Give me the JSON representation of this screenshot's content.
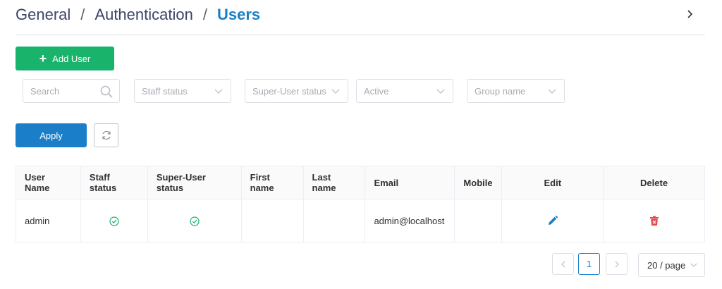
{
  "breadcrumb": {
    "items": [
      "General",
      "Authentication",
      "Users"
    ],
    "separator": "/"
  },
  "header": {
    "collapse_icon": "chevron-right-icon"
  },
  "toolbar": {
    "add_user_label": "Add User",
    "add_icon": "plus-icon"
  },
  "filters": {
    "search_placeholder": "Search",
    "staff_status_placeholder": "Staff status",
    "superuser_status_placeholder": "Super-User status",
    "active_placeholder": "Active",
    "group_name_placeholder": "Group name"
  },
  "actions": {
    "apply_label": "Apply",
    "reset_icon": "refresh-icon"
  },
  "table": {
    "columns": [
      "User Name",
      "Staff status",
      "Super-User status",
      "First name",
      "Last name",
      "Email",
      "Mobile",
      "Edit",
      "Delete"
    ],
    "rows": [
      {
        "user_name": "admin",
        "staff_status": "check-circle-icon",
        "superuser_status": "check-circle-icon",
        "first_name": "",
        "last_name": "",
        "email": "admin@localhost",
        "mobile": "",
        "edit_icon": "pencil-icon",
        "delete_icon": "trash-icon"
      }
    ]
  },
  "pagination": {
    "current_page": "1",
    "page_size": "20 / page"
  },
  "colors": {
    "primary": "#1a7fc8",
    "success": "#19b36c",
    "danger": "#e5484d",
    "breadcrumb_text": "#3d4566"
  }
}
